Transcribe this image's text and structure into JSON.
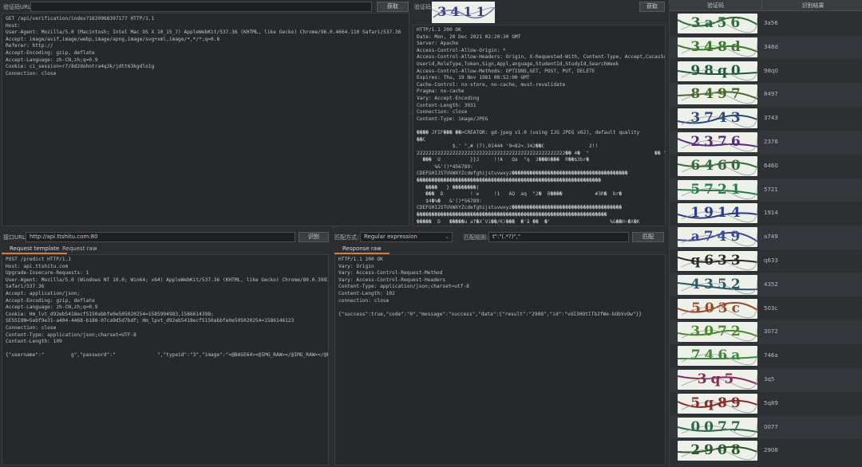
{
  "top_left": {
    "url_label": "验证码URL:",
    "url_value": "",
    "fetch_button": "获取",
    "request_lines": [
      "GET /api/verification/index?1639968397177 HTTP/1.1",
      "Host:",
      "User-Agent: Mozilla/5.0 (Macintosh; Intel Mac OS X 10_15_7) AppleWebKit/537.36 (KHTML, like Gecko) Chrome/96.0.4664.110 Safari/537.36",
      "Accept: image/avif,image/webp,image/apng,image/svg+xml,image/*,*/*;q=0.8",
      "Referer: http://",
      "Accept-Encoding: gzip, deflate",
      "Accept-Language: zh-CN,zh;q=0.9",
      "Cookie: ci_session=r7/8d2dohntra4q3k/jdtt63kgdlo1g",
      "Connection: close"
    ]
  },
  "top_middle": {
    "captcha_label": "验证码:",
    "captcha_text": "3411",
    "refresh_button": "获取",
    "response_lines": [
      "HTTP/1.1 200 OK",
      "Date: Mon, 20 Dec 2021 02:20:30 GMT",
      "Server: Apache",
      "Access-Control-Allow-Origin: *",
      "Access-Control-Allow-Headers: Origin, X-Requested-With, Content-Type, Accept,CucasSchoolid,",
      "Userid,RoleType,Token,Sign,Appl,anguage,StudentId,StudyId,SearchWeek",
      "Access-Control-Allow-Methods: OPTIONS,GET, POST, PUT, DELETE",
      "Expires: Thu, 19 Nov 1981 08:52:00 GMT",
      "Cache-Control: no-store, no-cache, must-revalidate",
      "Pragma: no-cache",
      "Vary: Accept-Encoding",
      "Content-Length: 3931",
      "Connection: close",
      "Content-Type: image/JPEG",
      "",
      "���� JFIF��� ��>CREATOR: gd-jpeg v1.0 (using IJG JPEG v62), default quality",
      "��C",
      "            $.' \",# (7),01444 '9=82<.342��C               2!!",
      "22222222222222222222222222222222222222222222222222�� 4�  \"                      �� \"��\"�\"�\"�\"�\"\"\"\"\"\"\"\"\"\"44 '9",
      "  ���  U          }}J     !!A   Qa  \"q  2���B���  R��$3br�",
      "      %&'()*456789:",
      "CDEFGHIJSTUVWXYZcdefghijstuvwxyz���������������������������������������",
      "��������������������������������������������������������������",
      "   ����   } ��������|",
      "   ���  D         ! w     !1   AQ  aq  \"2�  B����           #3R�  br�",
      "   $4�%�   &'()*56789:",
      "CDEFGHIJSTUVWXYZcdefghijstuvwxyz�������������������������������������",
      "����������������������������������������������������������������",
      "�����  D   �����u af�X`Vi��/K)���  �'ã ��  �'                    %&��H~�X�K",
      "(�O�    ��>�  ��  �eL/��  ��Y��  �V��]��  ,H�  ��9�Xg��Y���R"
    ]
  },
  "middle_left": {
    "url_label": "接口URL:",
    "url_value": "http://api.ttshitu.com:80",
    "recognize_button": "识别",
    "tabs": [
      "Request template",
      "Request raw"
    ],
    "request_lines": [
      "POST /predict HTTP/1.1",
      "Host: api.ttshitu.com",
      "Upgrade-Insecure-Requests: 1",
      "User-Agent: Mozilla/5.0 (Windows NT 10.0; Win64; x64) AppleWebKit/537.36 (KHTML, like Gecko) Chrome/80.0.3987.149",
      "Safari/537.36",
      "Accept: application/json;",
      "Accept-Encoding: gzip, deflate",
      "Accept-Language: zh-CN,zh;q=0.9",
      "Cookie: Hm_lvt_d92eb5418ecf5150abbfe0e505020254=1585994983,1586614398;",
      "SESSION=5ebf9e31-a404-4468-b188-07ca9d5d7bdf; Hm_lpvt_d92eb5418ecf5150abbfe0e505020254=1586146123",
      "Connection: close",
      "Content-Type: application/json;charset=UTF-8",
      "Content-Length: 109",
      "",
      "{\"username\":\"         g\",\"password\":\"              \",\"typeid\":\"3\",\"image\":\"<@BASE64><@IMG_RAW></@IMG_RAW></@BASE64>\"}"
    ]
  },
  "middle_right": {
    "match_label": "匹配方式:",
    "match_value": "Regular expression",
    "rule_label": "匹配规则:",
    "rule_value": "t\":\"(.*?)\",\"",
    "match_button": "匹配",
    "tabs": [
      "Response raw"
    ],
    "response_lines": [
      "HTTP/1.1 200 OK",
      "Vary: Origin",
      "Vary: Access-Control-Request-Method",
      "Vary: Access-Control-Request-Headers",
      "Content-Type: application/json;charset=utf-8",
      "Content-Length: 102",
      "connection: close",
      "",
      "{\"success\":true,\"code\":\"0\",\"message\":\"success\",\"data\":{\"result\":\"2908\",\"id\":\"vUI3HOtlTb2fWe-bUbVvOw\"}}"
    ]
  },
  "results": {
    "header_captcha": "验证码",
    "header_result": "识别结果",
    "rows": [
      {
        "captcha": "3a56",
        "result": "3a56",
        "color": "#2a6d3a"
      },
      {
        "captcha": "348d",
        "result": "348d",
        "color": "#3b7a2a"
      },
      {
        "captcha": "98q0",
        "result": "98q0",
        "color": "#1f5a3d"
      },
      {
        "captcha": "8497",
        "result": "8497",
        "color": "#4a6a2a"
      },
      {
        "captcha": "3743",
        "result": "3743",
        "color": "#2d4a7a"
      },
      {
        "captcha": "2376",
        "result": "2376",
        "color": "#5a2a7a"
      },
      {
        "captcha": "6460",
        "result": "6460",
        "color": "#3a6a3a"
      },
      {
        "captcha": "5721",
        "result": "5721",
        "color": "#2a7a4a"
      },
      {
        "captcha": "1914",
        "result": "1914",
        "color": "#2a3a8a"
      },
      {
        "captcha": "a749",
        "result": "a749",
        "color": "#3a4a9a"
      },
      {
        "captcha": "q633",
        "result": "q633",
        "color": "#2a2a2a"
      },
      {
        "captcha": "4352",
        "result": "4352",
        "color": "#2a5a6a"
      },
      {
        "captcha": "503c",
        "result": "503c",
        "color": "#9a4a2a"
      },
      {
        "captcha": "3072",
        "result": "3072",
        "color": "#4a8a2a"
      },
      {
        "captcha": "746a",
        "result": "746a",
        "color": "#3a8a3a"
      },
      {
        "captcha": "3q5",
        "result": "3q5",
        "color": "#8a2a5a"
      },
      {
        "captcha": "5q89",
        "result": "5q89",
        "color": "#8a2a2a"
      },
      {
        "captcha": "0077",
        "result": "0077",
        "color": "#2a6a4a"
      },
      {
        "captcha": "2908",
        "result": "2908",
        "color": "#2a5a2a"
      }
    ]
  }
}
